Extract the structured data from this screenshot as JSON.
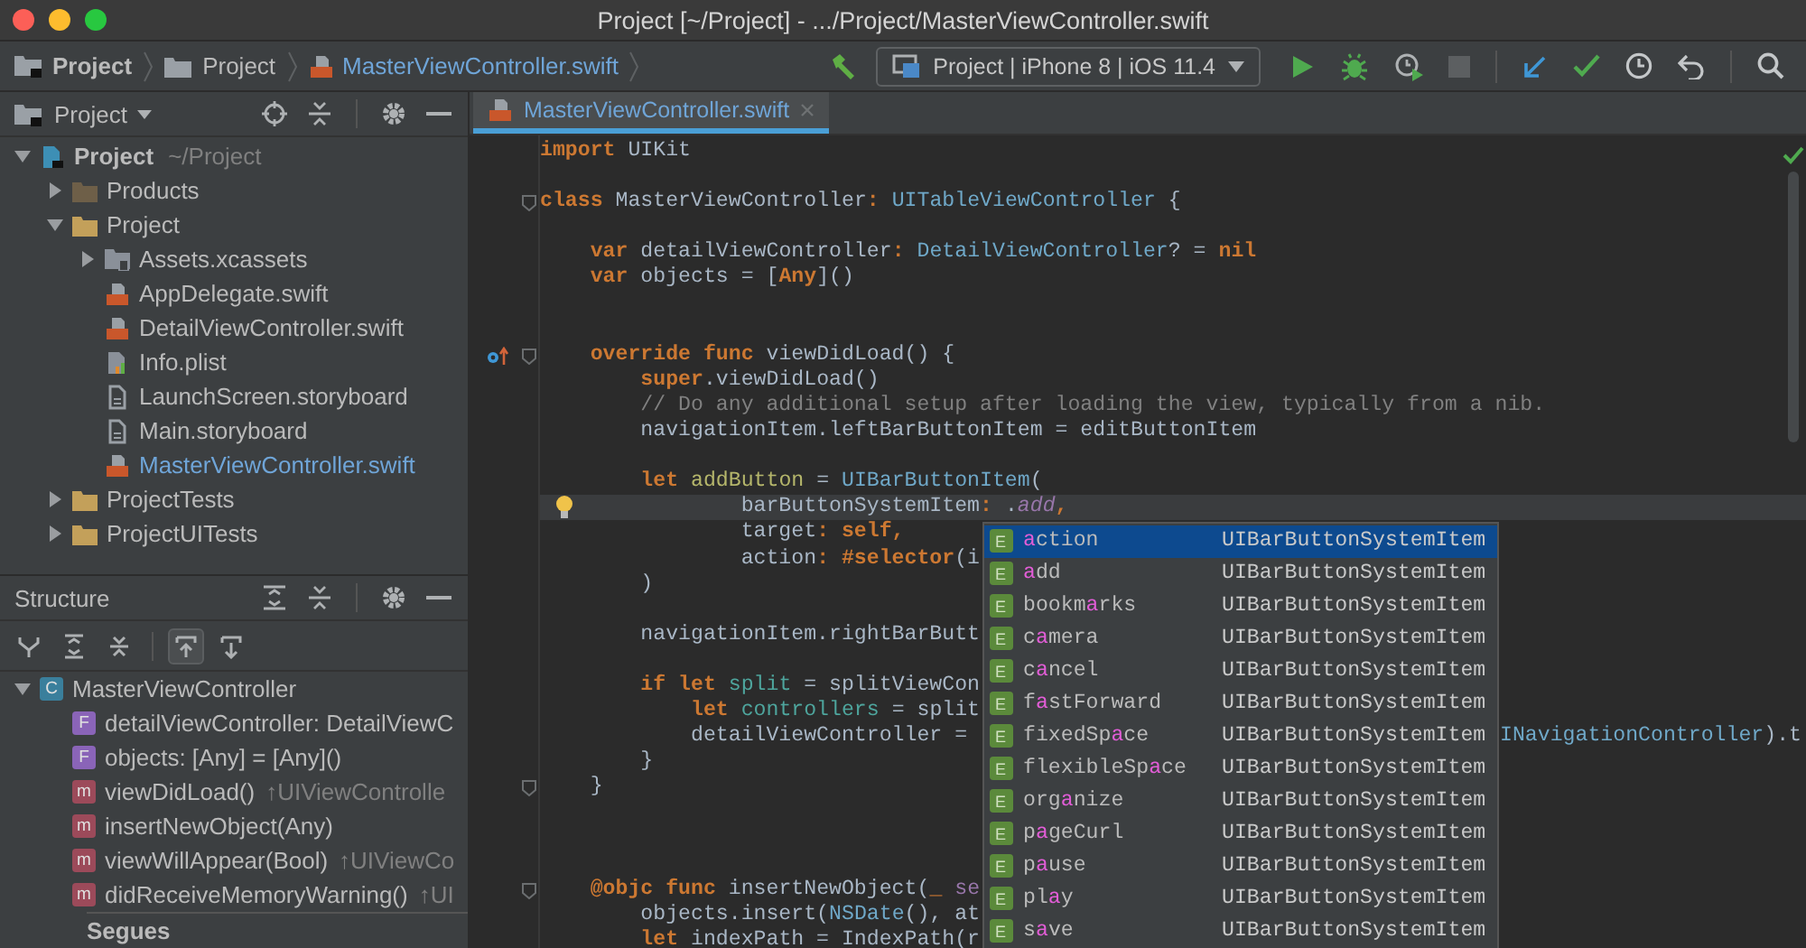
{
  "window": {
    "title": "Project [~/Project] - .../Project/MasterViewController.swift"
  },
  "breadcrumbs": [
    {
      "label": "Project",
      "kind": "project"
    },
    {
      "label": "Project",
      "kind": "folder"
    },
    {
      "label": "MasterViewController.swift",
      "kind": "swift"
    }
  ],
  "run_configuration": {
    "label": "Project | iPhone 8 | iOS 11.4"
  },
  "project_panel": {
    "title": "Project",
    "tree": [
      {
        "name": "Project",
        "detail": "~/Project",
        "kind": "project",
        "active": false,
        "expanded": true,
        "children": [
          {
            "name": "Products",
            "kind": "products",
            "active": false,
            "expanded": false
          },
          {
            "name": "Project",
            "kind": "folder",
            "active": false,
            "expanded": true,
            "children": [
              {
                "name": "Assets.xcassets",
                "kind": "xcassets",
                "active": false,
                "expanded": false
              },
              {
                "name": "AppDelegate.swift",
                "kind": "swift",
                "active": false
              },
              {
                "name": "DetailViewController.swift",
                "kind": "swift",
                "active": false
              },
              {
                "name": "Info.plist",
                "kind": "plist",
                "active": false
              },
              {
                "name": "LaunchScreen.storyboard",
                "kind": "storyboard",
                "active": false
              },
              {
                "name": "Main.storyboard",
                "kind": "storyboard",
                "active": false
              },
              {
                "name": "MasterViewController.swift",
                "kind": "swift",
                "active": true
              }
            ]
          },
          {
            "name": "ProjectTests",
            "kind": "folder",
            "active": false,
            "expanded": false
          },
          {
            "name": "ProjectUITests",
            "kind": "folder",
            "active": false,
            "expanded": false
          }
        ]
      }
    ]
  },
  "structure_panel": {
    "title": "Structure",
    "toolbar": [
      {
        "kind": "hierarchy",
        "on": false
      },
      {
        "kind": "expand",
        "on": false
      },
      {
        "kind": "collapse",
        "on": false
      },
      {
        "kind": "inherited",
        "on": true
      },
      {
        "kind": "fields",
        "on": false
      }
    ],
    "tree": [
      {
        "name": "MasterViewController",
        "kind": "class",
        "badge": "C",
        "expanded": true,
        "children": [
          {
            "name": "detailViewController: DetailViewC",
            "kind": "field",
            "badge": "F"
          },
          {
            "name": "objects: [Any] = [Any]()",
            "kind": "field",
            "badge": "F"
          },
          {
            "name": "viewDidLoad()",
            "inherits": "↑UIViewControlle",
            "kind": "method",
            "badge": "m"
          },
          {
            "name": "insertNewObject(Any)",
            "kind": "method",
            "badge": "m"
          },
          {
            "name": "viewWillAppear(Bool)",
            "inherits": "↑UIViewCo",
            "kind": "method",
            "badge": "m"
          },
          {
            "name": "didReceiveMemoryWarning()",
            "inherits": "↑UI",
            "kind": "method",
            "badge": "m"
          },
          {
            "name": "Segues",
            "kind": "section"
          }
        ]
      }
    ]
  },
  "editor": {
    "tabs": [
      {
        "label": "MasterViewController.swift",
        "selected": true
      }
    ],
    "lines": [
      {
        "kind": "code",
        "tokens": [
          {
            "kw": "import"
          },
          {
            "plain": " UIKit"
          }
        ]
      },
      {
        "kind": "blank"
      },
      {
        "kind": "code",
        "fold": true,
        "tokens": [
          {
            "kw": "class"
          },
          {
            "plain": " MasterViewController"
          },
          {
            "kw": ":"
          },
          {
            "type": " UITableViewController"
          },
          {
            "plain": " {"
          }
        ]
      },
      {
        "kind": "blank"
      },
      {
        "kind": "code",
        "tokens": [
          {
            "kw": "    var"
          },
          {
            "plain": " detailViewController"
          },
          {
            "kw": ":"
          },
          {
            "type": " DetailViewController"
          },
          {
            "plain": "? = "
          },
          {
            "kw": "nil"
          }
        ]
      },
      {
        "kind": "code",
        "tokens": [
          {
            "kw": "    var"
          },
          {
            "plain": " objects = ["
          },
          {
            "kw": "Any"
          },
          {
            "plain": "]()"
          }
        ]
      },
      {
        "kind": "blank"
      },
      {
        "kind": "blank"
      },
      {
        "kind": "code",
        "fold": true,
        "override": true,
        "tokens": [
          {
            "kw": "    override func"
          },
          {
            "plain": " viewDidLoad() {"
          }
        ]
      },
      {
        "kind": "code",
        "tokens": [
          {
            "kw": "        super"
          },
          {
            "plain": ".viewDidLoad()"
          }
        ]
      },
      {
        "kind": "code",
        "tokens": [
          {
            "comment": "        // Do any additional setup after loading the view, typically from a nib."
          }
        ]
      },
      {
        "kind": "code",
        "tokens": [
          {
            "plain": "        navigationItem.leftBarButtonItem = editButtonItem"
          }
        ]
      },
      {
        "kind": "blank"
      },
      {
        "kind": "code",
        "tokens": [
          {
            "kw": "        let"
          },
          {
            "decl": " addButton"
          },
          {
            "plain": " = "
          },
          {
            "type": "UIBarButtonItem"
          },
          {
            "plain": "("
          }
        ]
      },
      {
        "kind": "code",
        "bulb": true,
        "current": true,
        "tokens": [
          {
            "plain": "                barButtonSystemItem"
          },
          {
            "kw": ":"
          },
          {
            "plain": " ."
          },
          {
            "member": "add"
          },
          {
            "kw": ","
          }
        ]
      },
      {
        "kind": "code",
        "tokens": [
          {
            "plain": "                target"
          },
          {
            "kw": ": self,"
          }
        ]
      },
      {
        "kind": "code",
        "tokens": [
          {
            "plain": "                action"
          },
          {
            "kw": ": #selector"
          },
          {
            "plain": "(i"
          }
        ]
      },
      {
        "kind": "code",
        "tokens": [
          {
            "plain": "        )"
          }
        ]
      },
      {
        "kind": "blank"
      },
      {
        "kind": "code",
        "tokens": [
          {
            "plain": "        navigationItem.rightBarButt"
          }
        ]
      },
      {
        "kind": "blank"
      },
      {
        "kind": "code",
        "tokens": [
          {
            "kw": "        if let"
          },
          {
            "local": " split"
          },
          {
            "plain": " = splitViewCon"
          }
        ]
      },
      {
        "kind": "code",
        "tokens": [
          {
            "kw": "            let"
          },
          {
            "local": " controllers"
          },
          {
            "plain": " = split"
          }
        ]
      },
      {
        "kind": "code",
        "tokens": [
          {
            "plain": "            detailViewController ="
          }
        ],
        "tail": [
          {
            "type": "INavigationController"
          },
          {
            "plain": ").t"
          }
        ]
      },
      {
        "kind": "code",
        "tokens": [
          {
            "plain": "        }"
          }
        ]
      },
      {
        "kind": "code",
        "fold": true,
        "tokens": [
          {
            "plain": "    }"
          }
        ]
      },
      {
        "kind": "blank"
      },
      {
        "kind": "blank"
      },
      {
        "kind": "blank"
      },
      {
        "kind": "code",
        "fold": true,
        "tokens": [
          {
            "kw": "    @objc func"
          },
          {
            "plain": " insertNewObject("
          },
          {
            "kw": "_"
          },
          {
            "param": " se"
          }
        ]
      },
      {
        "kind": "code",
        "tokens": [
          {
            "plain": "        objects.insert("
          },
          {
            "type": "NSDate"
          },
          {
            "plain": "(), at"
          }
        ]
      },
      {
        "kind": "code",
        "tokens": [
          {
            "kw": "        let"
          },
          {
            "plain": " indexPath = IndexPath(r"
          }
        ]
      }
    ],
    "completion": [
      {
        "name": {
          "match": "a",
          "after": "ction"
        },
        "badge": "E",
        "type": "UIBarButtonSystemItem",
        "selected": true
      },
      {
        "name": {
          "match": "a",
          "after": "dd"
        },
        "badge": "E",
        "type": "UIBarButtonSystemItem",
        "selected": false
      },
      {
        "name": {
          "before": "bookm",
          "match": "a",
          "after": "rks"
        },
        "badge": "E",
        "type": "UIBarButtonSystemItem",
        "selected": false
      },
      {
        "name": {
          "before": "c",
          "match": "a",
          "after": "mera"
        },
        "badge": "E",
        "type": "UIBarButtonSystemItem",
        "selected": false
      },
      {
        "name": {
          "before": "c",
          "match": "a",
          "after": "ncel"
        },
        "badge": "E",
        "type": "UIBarButtonSystemItem",
        "selected": false
      },
      {
        "name": {
          "before": "f",
          "match": "a",
          "after": "stForward"
        },
        "badge": "E",
        "type": "UIBarButtonSystemItem",
        "selected": false
      },
      {
        "name": {
          "before": "fixedSp",
          "match": "a",
          "after": "ce"
        },
        "badge": "E",
        "type": "UIBarButtonSystemItem",
        "selected": false
      },
      {
        "name": {
          "before": "flexibleSp",
          "match": "a",
          "after": "ce"
        },
        "badge": "E",
        "type": "UIBarButtonSystemItem",
        "selected": false
      },
      {
        "name": {
          "before": "org",
          "match": "a",
          "after": "nize"
        },
        "badge": "E",
        "type": "UIBarButtonSystemItem",
        "selected": false
      },
      {
        "name": {
          "before": "p",
          "match": "a",
          "after": "geCurl"
        },
        "badge": "E",
        "type": "UIBarButtonSystemItem",
        "selected": false
      },
      {
        "name": {
          "before": "p",
          "match": "a",
          "after": "use"
        },
        "badge": "E",
        "type": "UIBarButtonSystemItem",
        "selected": false
      },
      {
        "name": {
          "before": "pl",
          "match": "a",
          "after": "y"
        },
        "badge": "E",
        "type": "UIBarButtonSystemItem",
        "selected": false
      },
      {
        "name": {
          "before": "s",
          "match": "a",
          "after": "ve"
        },
        "badge": "E",
        "type": "UIBarButtonSystemItem",
        "selected": false
      }
    ]
  }
}
